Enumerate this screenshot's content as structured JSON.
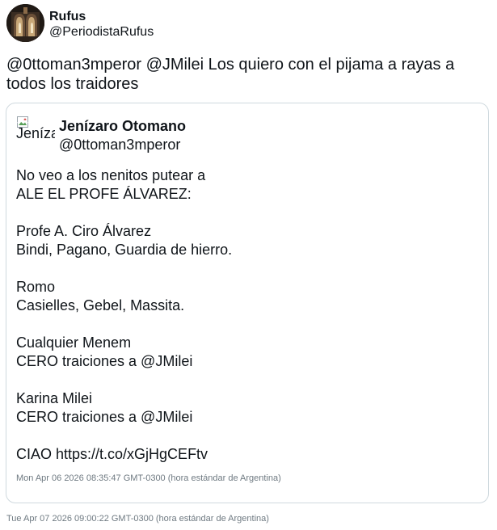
{
  "tweet": {
    "author": {
      "name": "Rufus",
      "handle": "@PeriodistaRufus",
      "avatar_icon": "profile-photo"
    },
    "text": "@0ttoman3mperor @JMilei Los quiero con el pijama a rayas a todos los traidores",
    "timestamp": "Tue Apr 07 2026 09:00:22 GMT-0300 (hora estándar de Argentina)"
  },
  "quote": {
    "author": {
      "name": "Jenízaro Otomano",
      "handle": "@0ttoman3mperor",
      "avatar_alt": "Jenízaro Otomano",
      "avatar_icon": "broken-image-icon"
    },
    "lines": [
      "No veo a los nenitos putear a",
      "ALE EL PROFE ÁLVAREZ:",
      "",
      "Profe A. Ciro Álvarez",
      "Bindi, Pagano, Guardia de hierro.",
      "",
      "Romo",
      "Casielles, Gebel, Massita.",
      "",
      "Cualquier Menem",
      "CERO traiciones a @JMilei",
      "",
      "Karina Milei",
      "CERO traiciones a @JMilei",
      "",
      "CIAO https://t.co/xGjHgCEFtv"
    ],
    "timestamp": "Mon Apr 06 2026 08:35:47 GMT-0300 (hora estándar de Argentina)"
  },
  "colors": {
    "text": "#0f1419",
    "border": "#cfd9de",
    "secondary_text": "#6f7a82"
  }
}
